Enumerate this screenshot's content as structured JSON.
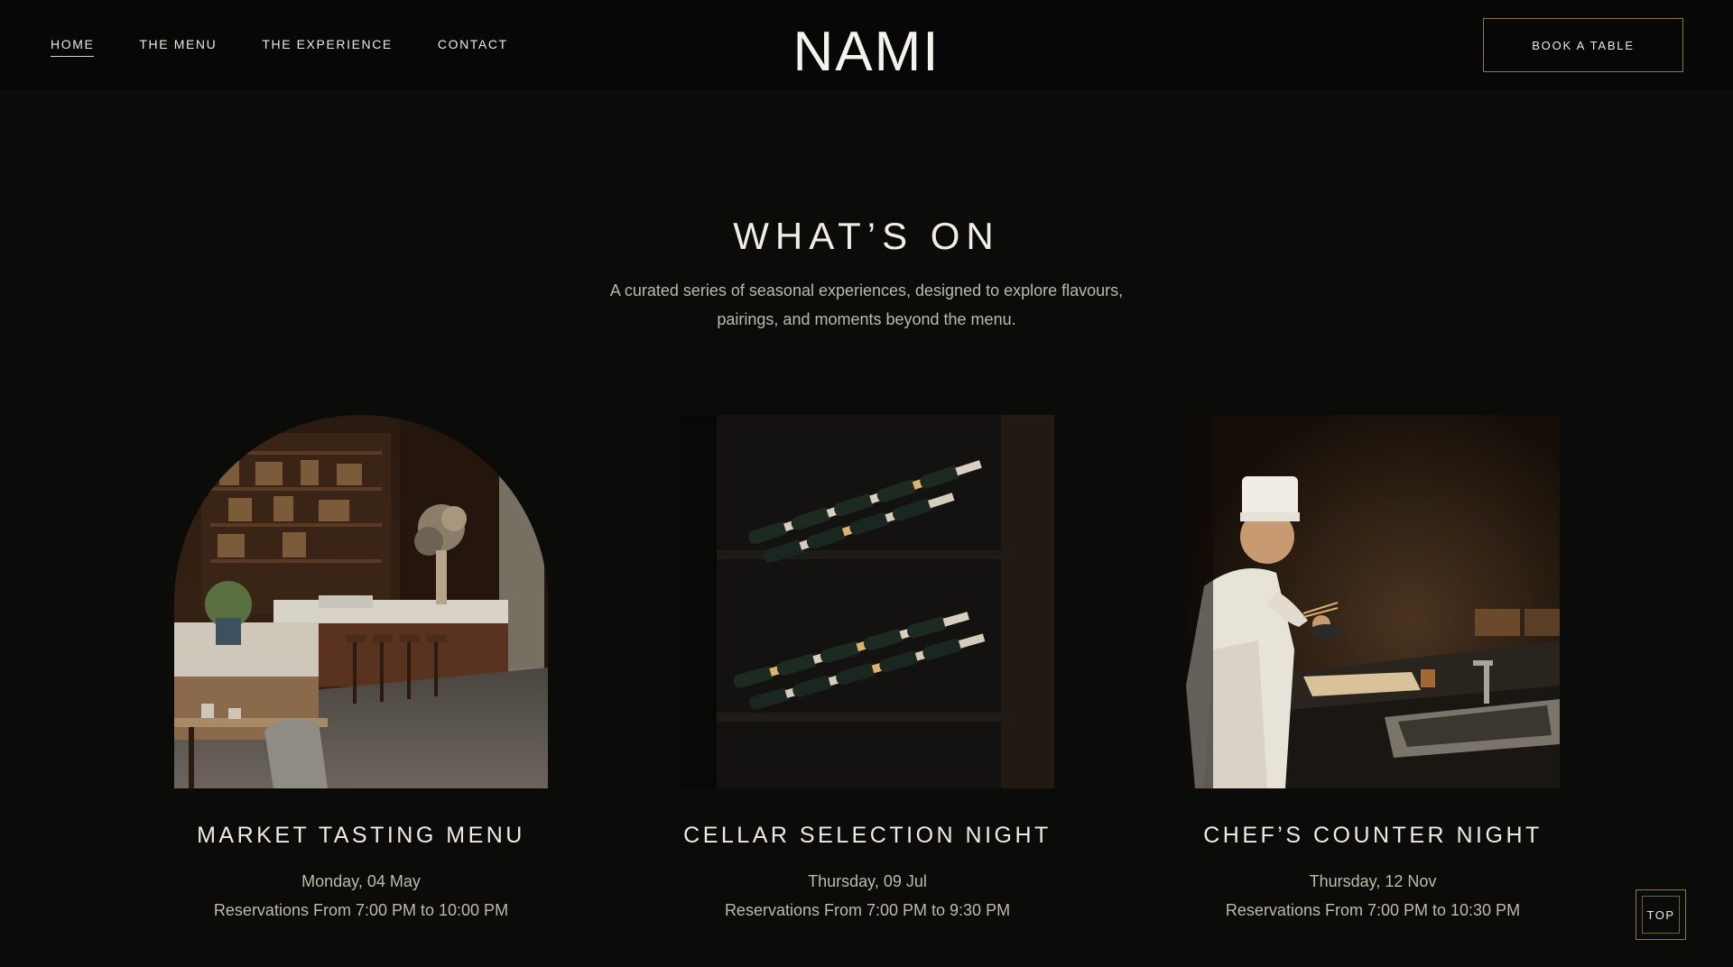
{
  "nav": {
    "items": [
      {
        "label": "HOME",
        "active": true
      },
      {
        "label": "THE MENU",
        "active": false
      },
      {
        "label": "THE EXPERIENCE",
        "active": false
      },
      {
        "label": "CONTACT",
        "active": false
      }
    ]
  },
  "logo": "NAMI",
  "book_button": "BOOK A TABLE",
  "section": {
    "title": "WHAT’S ON",
    "description_line1": "A curated series of seasonal experiences, designed to explore flavours,",
    "description_line2": "pairings, and moments beyond the menu."
  },
  "events": [
    {
      "title": "MARKET TASTING MENU",
      "date": "Monday, 04 May",
      "time": "Reservations From 7:00 PM to 10:00 PM",
      "image": "restaurant-interior-photo"
    },
    {
      "title": "CELLAR SELECTION NIGHT",
      "date": "Thursday, 09 Jul",
      "time": "Reservations From 7:00 PM to 9:30 PM",
      "image": "wine-bottles-rack-photo"
    },
    {
      "title": "CHEF’S COUNTER NIGHT",
      "date": "Thursday, 12 Nov",
      "time": "Reservations From 7:00 PM to 10:30 PM",
      "image": "chef-at-counter-photo"
    }
  ],
  "top_button": "TOP",
  "colors": {
    "background": "#0b0b0a",
    "header": "#070707",
    "accent_border": "#8a7550",
    "text": "#ece8e0",
    "muted_text": "#bdb8ad"
  }
}
